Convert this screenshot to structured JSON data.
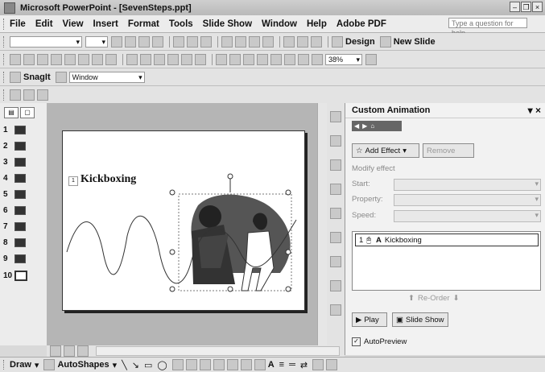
{
  "titlebar": {
    "title": "Microsoft PowerPoint - [SevenSteps.ppt]"
  },
  "menu": {
    "items": [
      "File",
      "Edit",
      "View",
      "Insert",
      "Format",
      "Tools",
      "Slide Show",
      "Window",
      "Help",
      "Adobe PDF"
    ],
    "help_placeholder": "Type a question for help"
  },
  "toolbar": {
    "design_label": "Design",
    "new_slide_label": "New Slide",
    "zoom": "38%"
  },
  "snagit": {
    "label": "SnagIt",
    "combo": "Window"
  },
  "slides": {
    "numbers": [
      "1",
      "2",
      "3",
      "4",
      "5",
      "6",
      "7",
      "8",
      "9",
      "10"
    ]
  },
  "slide": {
    "placeholder_num": "1",
    "title": "Kickboxing"
  },
  "taskpane": {
    "title": "Custom Animation",
    "add_effect": "Add Effect",
    "remove": "Remove",
    "modify_effect": "Modify effect",
    "start_label": "Start:",
    "property_label": "Property:",
    "speed_label": "Speed:",
    "anim_item_num": "1",
    "anim_item_label": "Kickboxing",
    "reorder": "Re-Order",
    "play": "Play",
    "slideshow": "Slide Show",
    "autopreview": "AutoPreview"
  },
  "drawbar": {
    "draw": "Draw",
    "autoshapes": "AutoShapes"
  },
  "colors": {
    "menubg": "#ececec",
    "canvas": "#b5b5b5",
    "taskpane": "#f2f2f2"
  }
}
